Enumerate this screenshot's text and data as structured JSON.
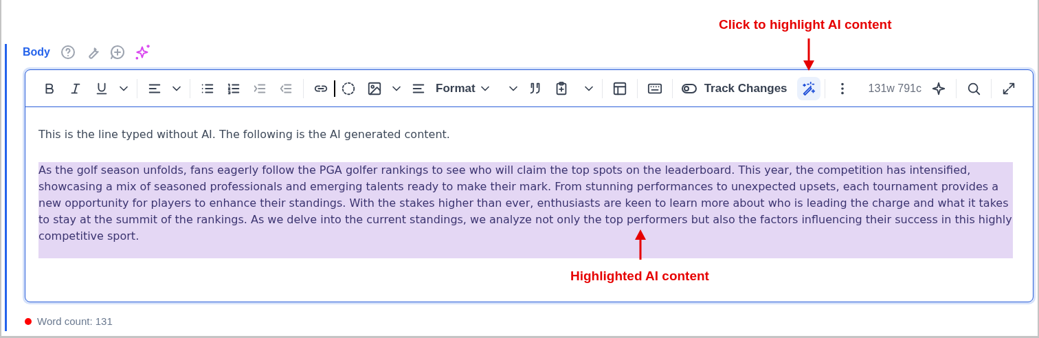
{
  "field": {
    "label": "Body"
  },
  "toolbar": {
    "format_label": "Format",
    "track_changes_label": "Track Changes",
    "counts": "131w 791c",
    "highlight_ai_selected": true
  },
  "content": [
    {
      "text": "This is the line typed without AI. The following is the AI generated content.",
      "ai_highlighted": false
    },
    {
      "text": "As the golf season unfolds, fans eagerly follow the PGA golfer rankings to see who will claim the top spots on the leaderboard. This year, the competition has intensified, showcasing a mix of seasoned professionals and emerging talents ready to make their mark. From stunning performances to unexpected upsets, each tournament provides a new opportunity for players to enhance their standings. With the stakes higher than ever, enthusiasts are keen to learn more about who is leading the charge and what it takes to stay at the summit of the rankings. As we delve into the current standings, we analyze not only the top performers but also the factors influencing their success in this highly competitive sport.",
      "ai_highlighted": true
    }
  ],
  "status": {
    "text": "Word count: 131",
    "color": "#ff0000"
  },
  "annotations": [
    {
      "text": "Click to highlight AI content",
      "kind": "toolbar"
    },
    {
      "text": "Highlighted AI content",
      "kind": "content"
    }
  ]
}
